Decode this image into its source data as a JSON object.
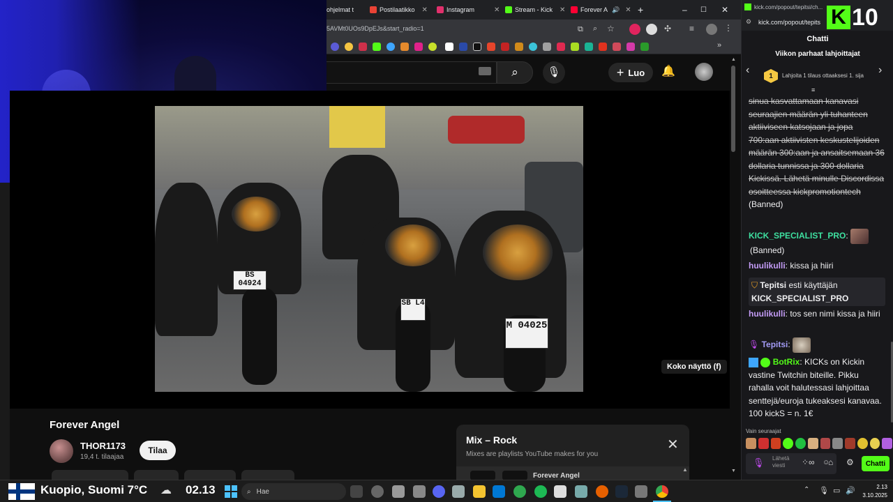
{
  "tabs": [
    {
      "label": "ohjelmat t",
      "color": "#e8eaed"
    },
    {
      "label": "Postilaatikko",
      "color": "#ea4335"
    },
    {
      "label": "Instagram",
      "color": "#e1306c"
    },
    {
      "label": "Stream - Kick",
      "color": "#53fc18"
    },
    {
      "label": "Forever A",
      "color": "#ff0033"
    }
  ],
  "browser": {
    "url_fragment": "5AVMt0UOs9DpEJs&start_radio=1"
  },
  "youtube": {
    "create_label": "Luo",
    "fullscreen_tip": "Koko näyttö (f)",
    "video_title": "Forever Angel",
    "channel_name": "THOR1173",
    "channel_subs": "19,4 t. tilaajaa",
    "subscribe_label": "Tilaa",
    "mix_title": "Mix – Rock",
    "mix_subtitle": "Mixes are playlists YouTube makes for you",
    "mix_next": "Forever Angel",
    "plates": [
      "BS 04924",
      "M 04025",
      "SB L4"
    ]
  },
  "kick": {
    "url_line1": "kick.com/popout/tepitsi/ch...",
    "url_line2": "kick.com/popout/tepits",
    "logo_letter": "K",
    "viewer_count": "10",
    "chat_tab": "Chatti",
    "gifters_title": "Viikon parhaat lahjoittajat",
    "gift_badge": "1",
    "gift_text": "Lahjoita 1 tilaus ottaaksesi 1. sija",
    "messages": {
      "m1_text": "sinua kasvattamaan kanavasi seuraajien määrän yli tuhanteen aktiiviseen katsojaan ja jopa 700:aan aktiivisten keskustelijoiden määrän 300:aan ja ansaitsemaan 36 dollaria tunnissa ja 300 dollaria Kickissä. Lähetä minulle Discordissa osoitteessa kickpromotiontech",
      "m1_status": "(Banned)",
      "m2_user": "KICK_SPECIALIST_PRO",
      "m2_status": "(Banned)",
      "m3_user": "huulikulli",
      "m3_text": "kissa ja hiiri",
      "m4_user": "Tepitsi",
      "m4_action": "esti käyttäjän",
      "m4_target": "KICK_SPECIALIST_PRO",
      "m5_user": "huulikulli",
      "m5_text": "tos sen nimi kissa ja hiiri",
      "m6_user": "Tepitsi",
      "m7_user": "BotRix",
      "m7_text": "KICKs on Kickin vastine Twitchin biteille. Pikku rahalla voit halutessasi lahjoittaa senttejä/euroja tukeaksesi kanavaa. 100 kickS = n. 1€"
    },
    "followers_only": "Vain seuraajat",
    "input_placeholder": "Lähetä viesti",
    "send_label": "Chatti"
  },
  "taskbar": {
    "weather": "Kuopio, Suomi 7°C",
    "time_big": "02.13",
    "search_placeholder": "Hae",
    "tray_time": "2.13",
    "tray_date": "3.10.2025"
  }
}
